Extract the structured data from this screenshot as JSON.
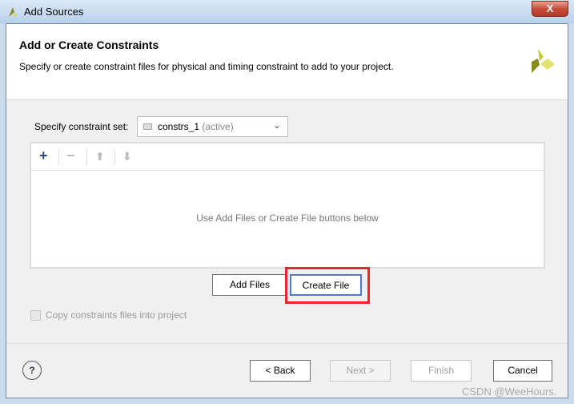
{
  "window": {
    "title": "Add Sources",
    "close_label": "X"
  },
  "header": {
    "title": "Add or Create Constraints",
    "subtitle": "Specify or create constraint files for physical and timing constraint to add to your project."
  },
  "constraint_set": {
    "label": "Specify constraint set:",
    "value": "constrs_1",
    "status": "(active)"
  },
  "toolbar": {
    "add": "+",
    "remove": "−",
    "up": "⬆",
    "down": "⬇"
  },
  "file_list": {
    "empty_text": "Use Add Files or Create File buttons below"
  },
  "buttons": {
    "add_files": "Add Files",
    "create_file": "Create File",
    "back": "< Back",
    "next": "Next >",
    "finish": "Finish",
    "cancel": "Cancel",
    "help": "?"
  },
  "copy_checkbox": {
    "label": "Copy constraints files into project",
    "checked": false,
    "enabled": false
  },
  "watermark": "CSDN @WeeHours."
}
